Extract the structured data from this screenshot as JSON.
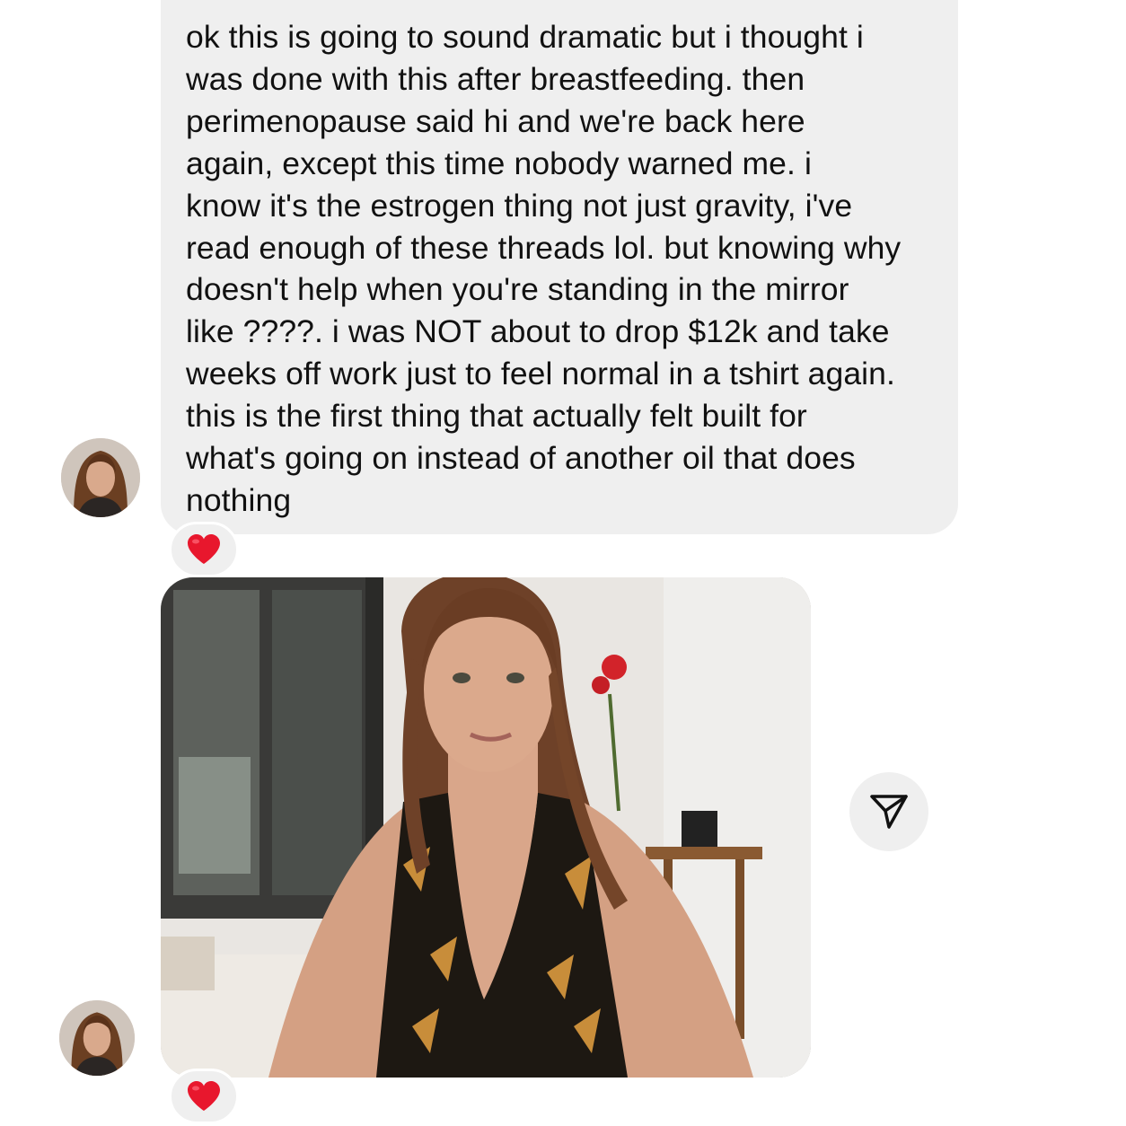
{
  "thread": {
    "messages": [
      {
        "type": "text",
        "text": "ok this is going to sound dramatic but i thought i\nwas done with this after breastfeeding. then\nperimenopause said hi and we're back here\nagain, except this time nobody warned me. i\nknow it's the estrogen thing not just gravity, i've\nread enough of these threads lol. but knowing why\ndoesn't help when you're standing in the mirror\nlike ????. i was NOT about to drop $12k and take\nweeks off work just to feel normal in a tshirt again.\nthis is the first thing that actually felt built for\nwhat's going on instead of another oil that does\nnothing",
        "reaction": "❤️",
        "bubble_color": "#efefef"
      },
      {
        "type": "photo",
        "reaction": "❤️"
      }
    ],
    "icons": {
      "avatar": "avatar",
      "reaction": "heart-icon",
      "share": "share-send-icon"
    },
    "colors": {
      "heart": "#e8172d",
      "background": "#ffffff",
      "button_bg": "#efefef"
    }
  }
}
